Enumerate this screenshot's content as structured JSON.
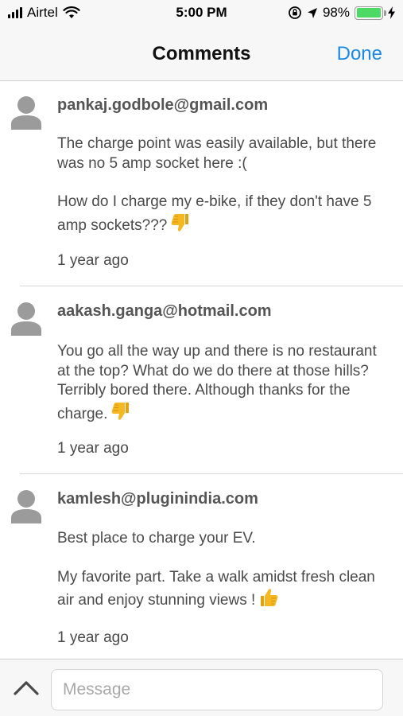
{
  "status_bar": {
    "carrier": "Airtel",
    "time": "5:00 PM",
    "battery": "98%",
    "battery_level": 0.98
  },
  "nav": {
    "title": "Comments",
    "done_label": "Done"
  },
  "comments": [
    {
      "author": "pankaj.godbole@gmail.com",
      "paragraphs": [
        "The charge point was easily available, but there was no 5 amp socket here :(",
        "How do I charge my e-bike, if they don't have 5 amp sockets???"
      ],
      "emoji": "thumbs-down",
      "age": "1 year ago"
    },
    {
      "author": "aakash.ganga@hotmail.com",
      "paragraphs": [
        "You go all the way up and there is no restaurant at the top?  What do we do there at those hills?  Terribly bored there.  Although thanks for the charge."
      ],
      "emoji": "thumbs-down",
      "age": "1 year ago"
    },
    {
      "author": "kamlesh@pluginindia.com",
      "paragraphs": [
        "Best place to charge your EV.",
        "My favorite part.  Take a walk amidst fresh clean air and enjoy stunning views !"
      ],
      "emoji": "thumbs-up",
      "age": "1 year ago"
    }
  ],
  "composer": {
    "placeholder": "Message"
  },
  "colors": {
    "accent": "#1a8ae6",
    "battery_green": "#4cd964",
    "emoji_yellow": "#f5b820"
  }
}
